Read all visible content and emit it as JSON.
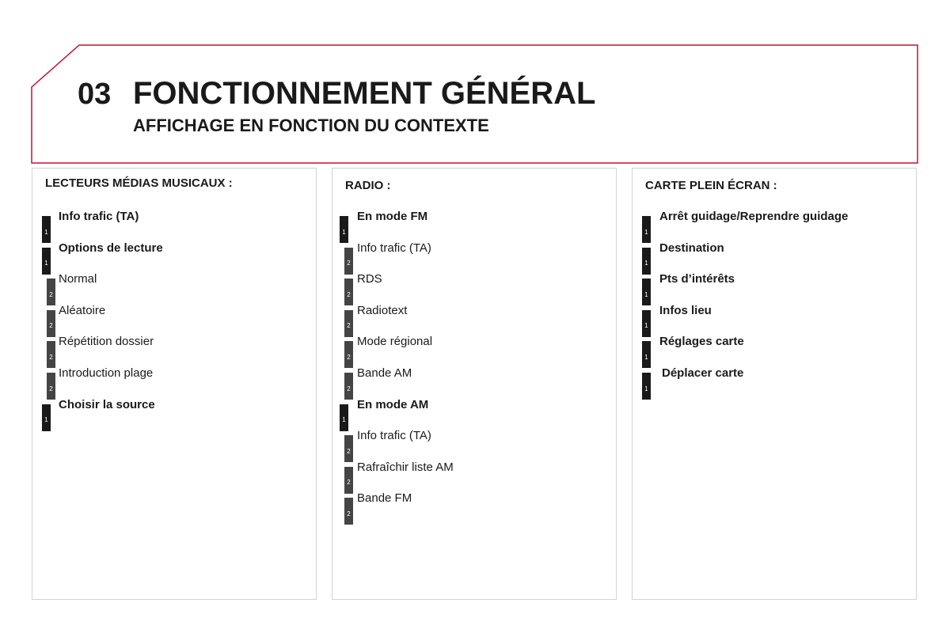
{
  "header": {
    "chapter_number": "03",
    "title": "FONCTIONNEMENT GÉNÉRAL",
    "subtitle": "AFFICHAGE EN FONCTION DU CONTEXTE",
    "frame_color": "#c8102e"
  },
  "panels": [
    {
      "title": "LECTEURS MÉDIAS MUSICAUX :",
      "items": [
        {
          "level": "1",
          "label": "Info trafic (TA)"
        },
        {
          "level": "1",
          "label": "Options de lecture"
        },
        {
          "level": "2",
          "label": "Normal"
        },
        {
          "level": "2",
          "label": "Aléatoire"
        },
        {
          "level": "2",
          "label": "Répétition dossier"
        },
        {
          "level": "2",
          "label": "Introduction plage"
        },
        {
          "level": "1",
          "label": "Choisir la source"
        }
      ]
    },
    {
      "title": "RADIO :",
      "items": [
        {
          "level": "1",
          "label": "En mode FM"
        },
        {
          "level": "2",
          "label": "Info trafic (TA)"
        },
        {
          "level": "2",
          "label": "RDS"
        },
        {
          "level": "2",
          "label": "Radiotext"
        },
        {
          "level": "2",
          "label": "Mode régional"
        },
        {
          "level": "2",
          "label": "Bande AM"
        },
        {
          "level": "1",
          "label": "En mode AM"
        },
        {
          "level": "2",
          "label": "Info trafic (TA)"
        },
        {
          "level": "2",
          "label": "Rafraîchir liste AM"
        },
        {
          "level": "2",
          "label": "Bande FM"
        }
      ]
    },
    {
      "title": "CARTE PLEIN ÉCRAN :",
      "items": [
        {
          "level": "1",
          "label": "Arrêt guidage/Reprendre guidage"
        },
        {
          "level": "1",
          "label": "Destination"
        },
        {
          "level": "1",
          "label": "Pts d’intérêts"
        },
        {
          "level": "1",
          "label": "Infos lieu"
        },
        {
          "level": "1",
          "label": "Réglages carte"
        },
        {
          "level": "1",
          "label": "Déplacer carte"
        }
      ]
    }
  ]
}
